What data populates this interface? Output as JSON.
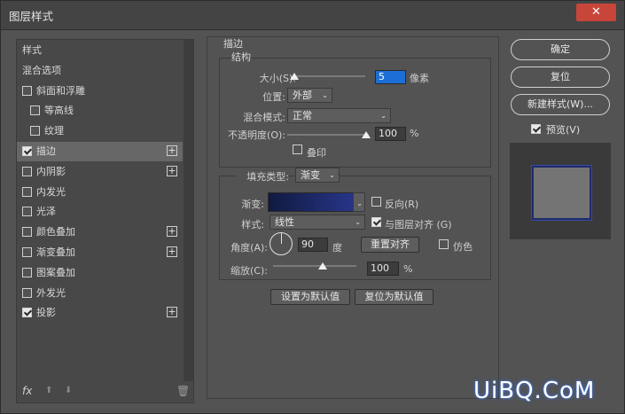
{
  "window": {
    "title": "图层样式",
    "close_glyph": "✕"
  },
  "left_panel": {
    "items": [
      {
        "label": "样式",
        "checkbox": false,
        "checked": false,
        "plus": false,
        "selected": false,
        "indent": 0
      },
      {
        "label": "混合选项",
        "checkbox": false,
        "checked": false,
        "plus": false,
        "selected": false,
        "indent": 0
      },
      {
        "label": "斜面和浮雕",
        "checkbox": true,
        "checked": false,
        "plus": false,
        "selected": false,
        "indent": 0
      },
      {
        "label": "等高线",
        "checkbox": true,
        "checked": false,
        "plus": false,
        "selected": false,
        "indent": 1
      },
      {
        "label": "纹理",
        "checkbox": true,
        "checked": false,
        "plus": false,
        "selected": false,
        "indent": 1
      },
      {
        "label": "描边",
        "checkbox": true,
        "checked": true,
        "plus": true,
        "selected": true,
        "indent": 0
      },
      {
        "label": "内阴影",
        "checkbox": true,
        "checked": false,
        "plus": true,
        "selected": false,
        "indent": 0
      },
      {
        "label": "内发光",
        "checkbox": true,
        "checked": false,
        "plus": false,
        "selected": false,
        "indent": 0
      },
      {
        "label": "光泽",
        "checkbox": true,
        "checked": false,
        "plus": false,
        "selected": false,
        "indent": 0
      },
      {
        "label": "颜色叠加",
        "checkbox": true,
        "checked": false,
        "plus": true,
        "selected": false,
        "indent": 0
      },
      {
        "label": "渐变叠加",
        "checkbox": true,
        "checked": false,
        "plus": true,
        "selected": false,
        "indent": 0
      },
      {
        "label": "图案叠加",
        "checkbox": true,
        "checked": false,
        "plus": false,
        "selected": false,
        "indent": 0
      },
      {
        "label": "外发光",
        "checkbox": true,
        "checked": false,
        "plus": false,
        "selected": false,
        "indent": 0
      },
      {
        "label": "投影",
        "checkbox": true,
        "checked": true,
        "plus": true,
        "selected": false,
        "indent": 0
      }
    ],
    "footer": {
      "fx": "fx",
      "up": "⬆",
      "down": "⬇",
      "trash": "🗑"
    }
  },
  "stroke": {
    "section_title": "描边",
    "structure_title": "结构",
    "size_label": "大小(S):",
    "size_value": "5",
    "size_unit": "像素",
    "position_label": "位置:",
    "position_value": "外部",
    "blend_label": "混合模式:",
    "blend_value": "正常",
    "opacity_label": "不透明度(O):",
    "opacity_value": "100",
    "opacity_unit": "%",
    "overprint_label": "叠印",
    "fill_type_label": "填充类型:",
    "fill_type_value": "渐变",
    "gradient_label": "渐变:",
    "reverse_label": "反向(R)",
    "style_label": "样式:",
    "style_value": "线性",
    "align_label": "与图层对齐 (G)",
    "angle_label": "角度(A):",
    "angle_value": "90",
    "angle_unit": "度",
    "reset_align_label": "重置对齐",
    "dither_label": "仿色",
    "scale_label": "缩放(C):",
    "scale_value": "100",
    "scale_unit": "%",
    "make_default_label": "设置为默认值",
    "reset_default_label": "复位为默认值"
  },
  "right": {
    "ok_label": "确定",
    "reset_label": "复位",
    "new_style_label": "新建样式(W)...",
    "preview_label": "预览(V)"
  },
  "watermark": "UiBQ.CoM",
  "colors": {
    "accent": "#1c6fd6",
    "gradient_start": "#101a40",
    "gradient_end": "#2a3890",
    "close": "#c8453a"
  }
}
